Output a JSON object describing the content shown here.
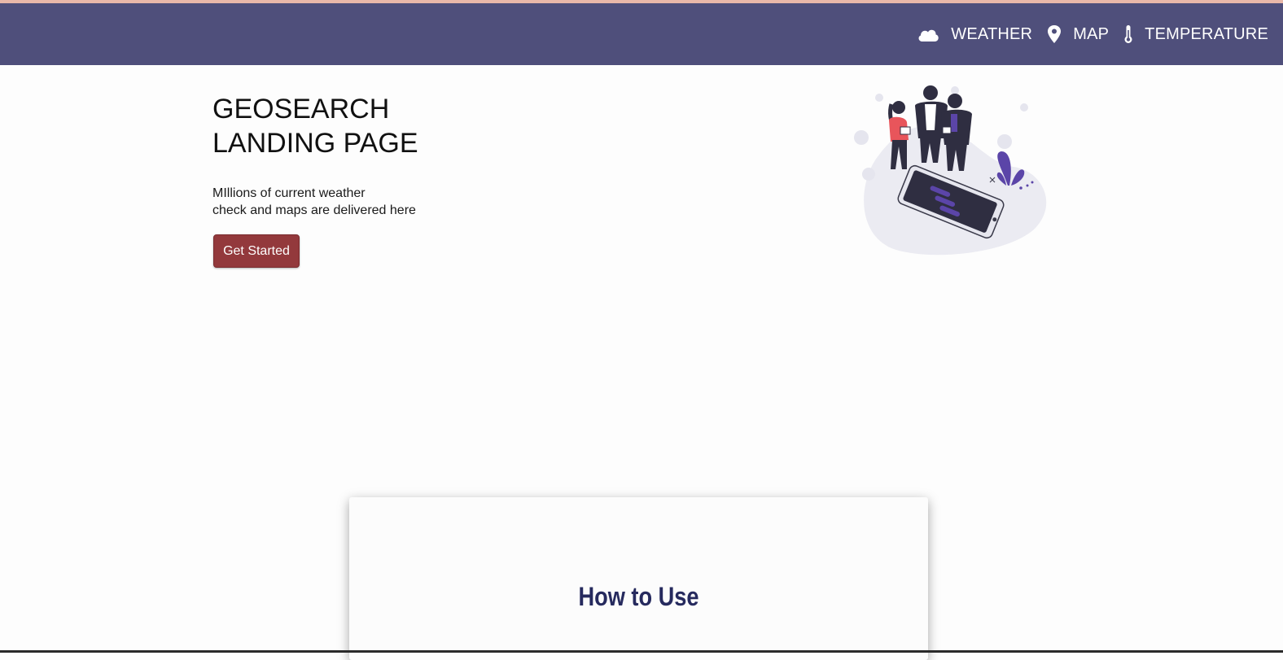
{
  "colors": {
    "navbar": "#4f4f7b",
    "top_strip": "#e9b8a9",
    "cta_background": "#93393c",
    "card_title": "#262a5e",
    "illustration_accent": "#5b45a8",
    "illustration_person_red": "#e8555b"
  },
  "nav": {
    "items": [
      {
        "icon": "cloud-icon",
        "label": "WEATHER"
      },
      {
        "icon": "map-pin-icon",
        "label": "MAP"
      },
      {
        "icon": "thermometer-icon",
        "label": "TEMPERATURE"
      }
    ]
  },
  "hero": {
    "title_line1": "GEOSEARCH",
    "title_line2": "LANDING PAGE",
    "subtitle_line1": "MIllions of current weather",
    "subtitle_line2": "check and maps are delivered here",
    "cta_label": "Get Started",
    "illustration": "people-with-phone-illustration"
  },
  "section": {
    "title": "How to Use"
  }
}
